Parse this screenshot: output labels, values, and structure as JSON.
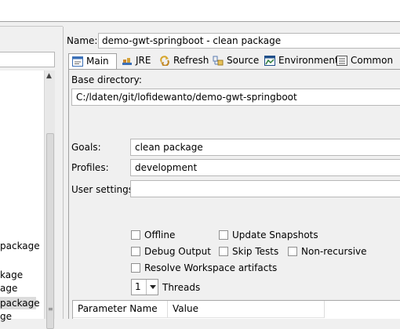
{
  "left_tree": {
    "items": [
      {
        "label": "package",
        "selected": false
      },
      {
        "label": "kage",
        "selected": false
      },
      {
        "label": "age",
        "selected": false
      },
      {
        "label": "package",
        "selected": true
      },
      {
        "label": "ge",
        "selected": false
      }
    ]
  },
  "config": {
    "name_label": "Name:",
    "name_value": "demo-gwt-springboot - clean package"
  },
  "tabs": [
    {
      "label": "Main",
      "icon": "main-tab-icon",
      "active": true
    },
    {
      "label": "JRE",
      "icon": "jre-icon",
      "active": false
    },
    {
      "label": "Refresh",
      "icon": "refresh-icon",
      "active": false
    },
    {
      "label": "Source",
      "icon": "source-icon",
      "active": false
    },
    {
      "label": "Environment",
      "icon": "environment-icon",
      "active": false
    },
    {
      "label": "Common",
      "icon": "common-icon",
      "active": false
    }
  ],
  "main": {
    "base_dir_label": "Base directory:",
    "base_dir_value": "C:/ldaten/git/lofidewanto/demo-gwt-springboot",
    "goals_label": "Goals:",
    "goals_value": "clean package",
    "profiles_label": "Profiles:",
    "profiles_value": "development",
    "user_settings_label": "User settings:",
    "user_settings_value": "",
    "options": {
      "offline": {
        "label": "Offline",
        "checked": false
      },
      "update_snapshots": {
        "label": "Update Snapshots",
        "checked": false
      },
      "debug_output": {
        "label": "Debug Output",
        "checked": false
      },
      "skip_tests": {
        "label": "Skip Tests",
        "checked": false
      },
      "non_recursive": {
        "label": "Non-recursive",
        "checked": false
      },
      "resolve_workspace": {
        "label": "Resolve Workspace artifacts",
        "checked": false
      }
    },
    "threads_value": "1",
    "threads_label": "Threads",
    "table_headers": [
      "Parameter Name",
      "Value"
    ]
  }
}
